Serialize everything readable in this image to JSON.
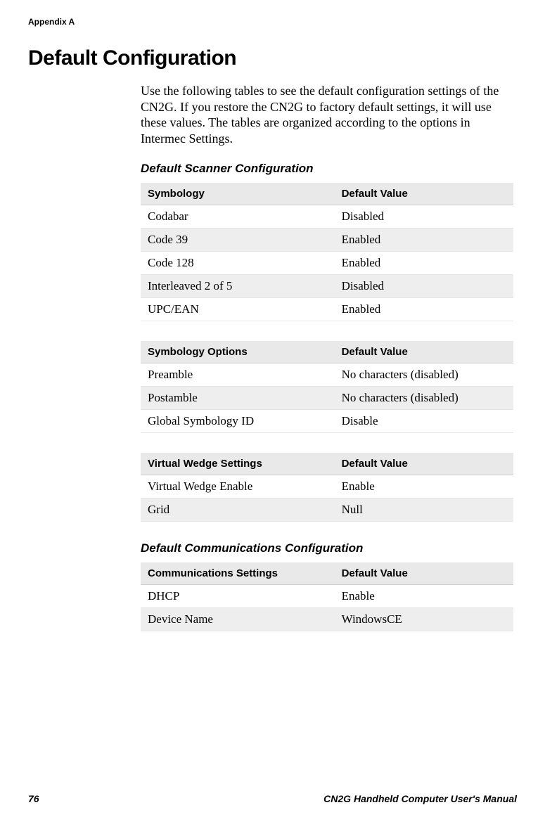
{
  "running_head": "Appendix A",
  "title": "Default Configuration",
  "intro": "Use the following tables to see the default configuration settings of the CN2G. If you restore the CN2G to factory default settings, it will use these values. The tables are organized according to the options in Intermec Settings.",
  "section_scanner": "Default Scanner Configuration",
  "table_symbology": {
    "col1": "Symbology",
    "col2": "Default Value",
    "rows": [
      {
        "c1": "Codabar",
        "c2": "Disabled"
      },
      {
        "c1": "Code 39",
        "c2": "Enabled"
      },
      {
        "c1": "Code 128",
        "c2": "Enabled"
      },
      {
        "c1": "Interleaved 2 of 5",
        "c2": "Disabled"
      },
      {
        "c1": "UPC/EAN",
        "c2": "Enabled"
      }
    ]
  },
  "table_sym_options": {
    "col1": "Symbology Options",
    "col2": "Default Value",
    "rows": [
      {
        "c1": "Preamble",
        "c2": "No characters (disabled)"
      },
      {
        "c1": "Postamble",
        "c2": "No characters (disabled)"
      },
      {
        "c1": "Global Symbology ID",
        "c2": "Disable"
      }
    ]
  },
  "table_virtual_wedge": {
    "col1": "Virtual Wedge Settings",
    "col2": "Default Value",
    "rows": [
      {
        "c1": "Virtual Wedge Enable",
        "c2": "Enable"
      },
      {
        "c1": "Grid",
        "c2": "Null"
      }
    ]
  },
  "section_comm": "Default Communications Configuration",
  "table_comm": {
    "col1": "Communications Settings",
    "col2": "Default Value",
    "rows": [
      {
        "c1": "DHCP",
        "c2": "Enable"
      },
      {
        "c1": "Device Name",
        "c2": "WindowsCE"
      }
    ]
  },
  "footer": {
    "page_num": "76",
    "doc_title": "CN2G Handheld Computer User's Manual"
  }
}
